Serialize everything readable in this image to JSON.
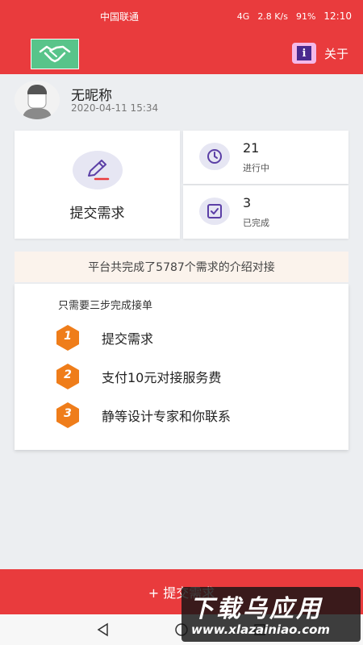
{
  "status": {
    "carrier": "中国联通",
    "network": "4G",
    "speed": "2.8 K/s",
    "battery": "91%",
    "time": "12:10"
  },
  "header": {
    "about_label": "关于",
    "about_icon_glyph": "i",
    "logo_icon": "handshake-icon"
  },
  "user": {
    "name": "无昵称",
    "time": "2020-04-11 15:34"
  },
  "actions": {
    "submit_label": "提交需求"
  },
  "stats": [
    {
      "value": "21",
      "label": "进行中",
      "icon": "clock-icon"
    },
    {
      "value": "3",
      "label": "已完成",
      "icon": "checkbox-icon"
    }
  ],
  "banner": {
    "text": "平台共完成了5787个需求的介绍对接"
  },
  "steps": {
    "title": "只需要三步完成接单",
    "items": [
      {
        "num": "1",
        "text": "提交需求"
      },
      {
        "num": "2",
        "text": "支付10元对接服务费"
      },
      {
        "num": "3",
        "text": "静等设计专家和你联系"
      }
    ]
  },
  "bottom": {
    "submit_label": "+ 提交需求"
  },
  "watermark": {
    "title": "下载乌应用",
    "url": "www.xlazainiao.com"
  },
  "colors": {
    "primary": "#e93b3d",
    "logo_bg": "#58c48a",
    "step_badge": "#ef7d1a",
    "icon_purple": "#5b3fa6"
  }
}
